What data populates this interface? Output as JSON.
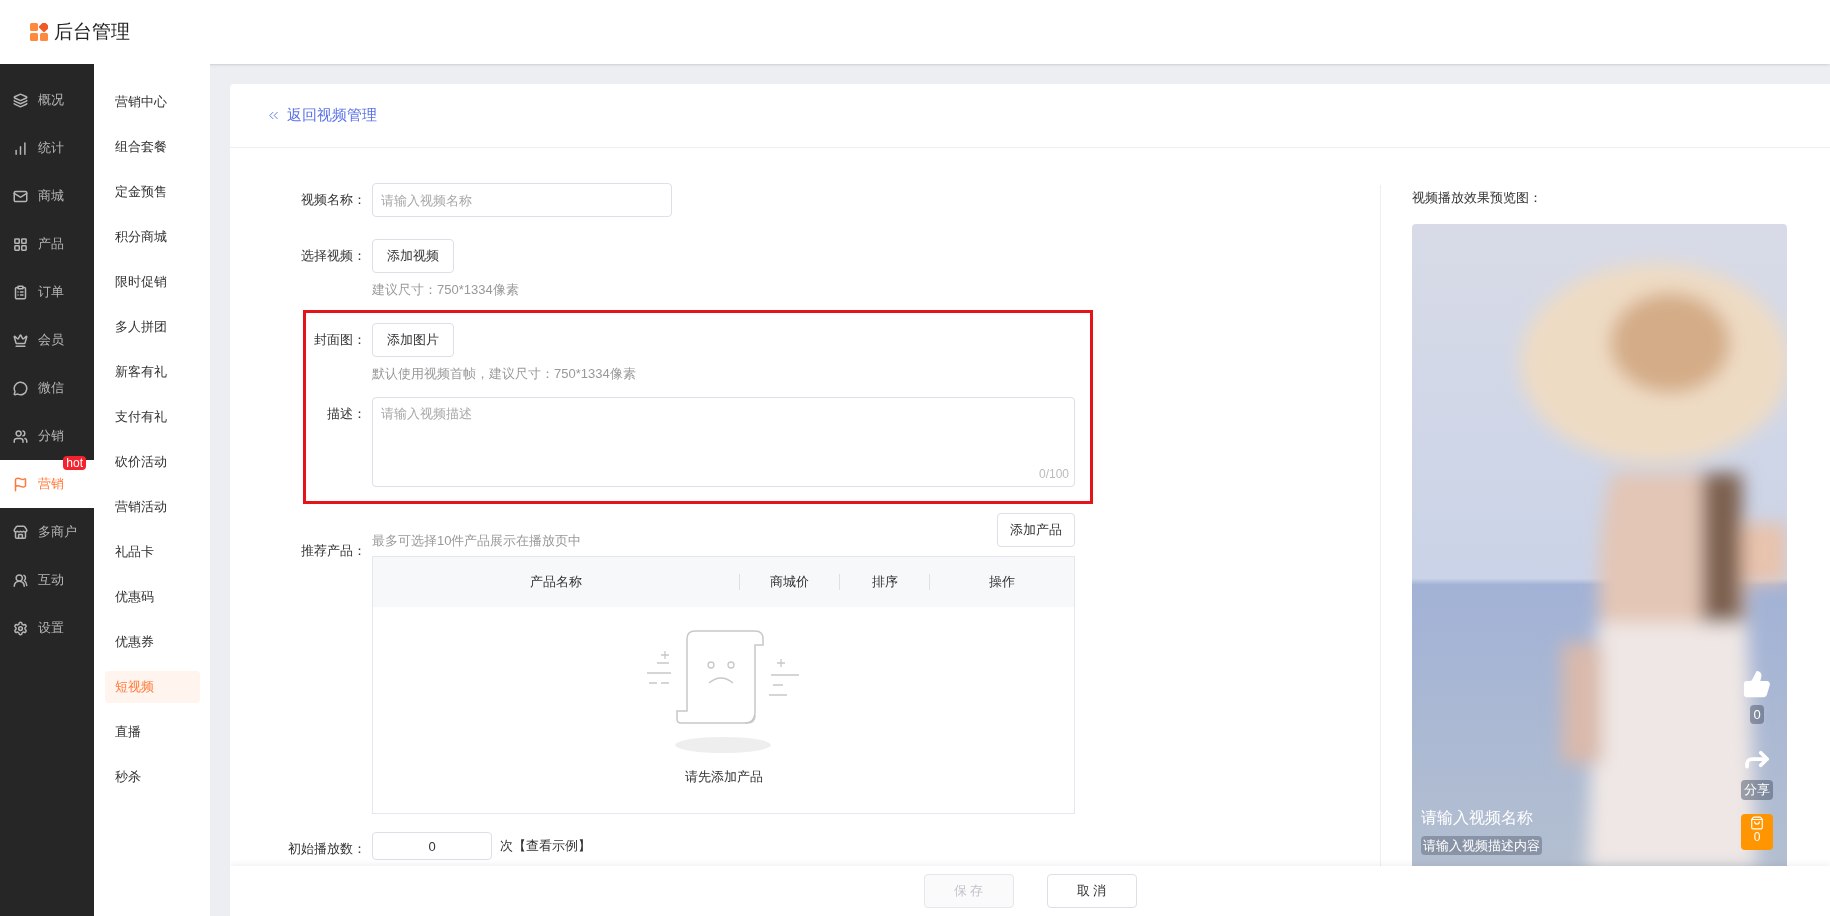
{
  "header": {
    "title": "后台管理"
  },
  "main_nav": [
    {
      "label": "概况",
      "selected": false
    },
    {
      "label": "统计",
      "selected": false
    },
    {
      "label": "商城",
      "selected": false
    },
    {
      "label": "产品",
      "selected": false
    },
    {
      "label": "订单",
      "selected": false
    },
    {
      "label": "会员",
      "selected": false
    },
    {
      "label": "微信",
      "selected": false
    },
    {
      "label": "分销",
      "selected": false
    },
    {
      "label": "营销",
      "selected": true,
      "badge": "hot"
    },
    {
      "label": "多商户",
      "selected": false
    },
    {
      "label": "互动",
      "selected": false
    },
    {
      "label": "设置",
      "selected": false
    }
  ],
  "sub_nav": [
    {
      "label": "营销中心",
      "selected": false
    },
    {
      "label": "组合套餐",
      "selected": false
    },
    {
      "label": "定金预售",
      "selected": false
    },
    {
      "label": "积分商城",
      "selected": false
    },
    {
      "label": "限时促销",
      "selected": false
    },
    {
      "label": "多人拼团",
      "selected": false
    },
    {
      "label": "新客有礼",
      "selected": false
    },
    {
      "label": "支付有礼",
      "selected": false
    },
    {
      "label": "砍价活动",
      "selected": false
    },
    {
      "label": "营销活动",
      "selected": false
    },
    {
      "label": "礼品卡",
      "selected": false
    },
    {
      "label": "优惠码",
      "selected": false
    },
    {
      "label": "优惠券",
      "selected": false
    },
    {
      "label": "短视频",
      "selected": true
    },
    {
      "label": "直播",
      "selected": false
    },
    {
      "label": "秒杀",
      "selected": false
    }
  ],
  "back_link": "返回视频管理",
  "form": {
    "sections": [
      {
        "highlighted": false,
        "fields": [
          {
            "kind": "text_input",
            "label": "视频名称：",
            "placeholder": "请输入视频名称"
          },
          {
            "kind": "upload",
            "label": "选择视频：",
            "button": "添加视频",
            "hint": "建议尺寸：750*1334像素"
          }
        ]
      },
      {
        "highlighted": true,
        "fields": [
          {
            "kind": "upload",
            "label": "封面图：",
            "button": "添加图片",
            "hint": "默认使用视频首帧，建议尺寸：750*1334像素"
          },
          {
            "kind": "textarea",
            "label": "描述：",
            "placeholder": "请输入视频描述",
            "counter": "0/100"
          }
        ]
      },
      {
        "highlighted": false,
        "fields": [
          {
            "kind": "products",
            "label": "推荐产品：",
            "note": "最多可选择10件产品展示在播放页中",
            "button": "添加产品",
            "columns": [
              "产品名称",
              "商城价",
              "排序",
              "操作"
            ],
            "empty_text": "请先添加产品"
          },
          {
            "kind": "number_input",
            "label": "初始播放数：",
            "value": "0",
            "suffix": "次",
            "link": "【查看示例】"
          }
        ]
      }
    ]
  },
  "preview": {
    "title": "视频播放效果预览图：",
    "video_title": "请输入视频名称",
    "video_description": "请输入视频描述内容",
    "likes": "0",
    "share": "分享",
    "cart_count": "0"
  },
  "footer": {
    "buttons": [
      {
        "label": "保 存",
        "disabled": true
      },
      {
        "label": "取 消",
        "disabled": false
      }
    ]
  }
}
